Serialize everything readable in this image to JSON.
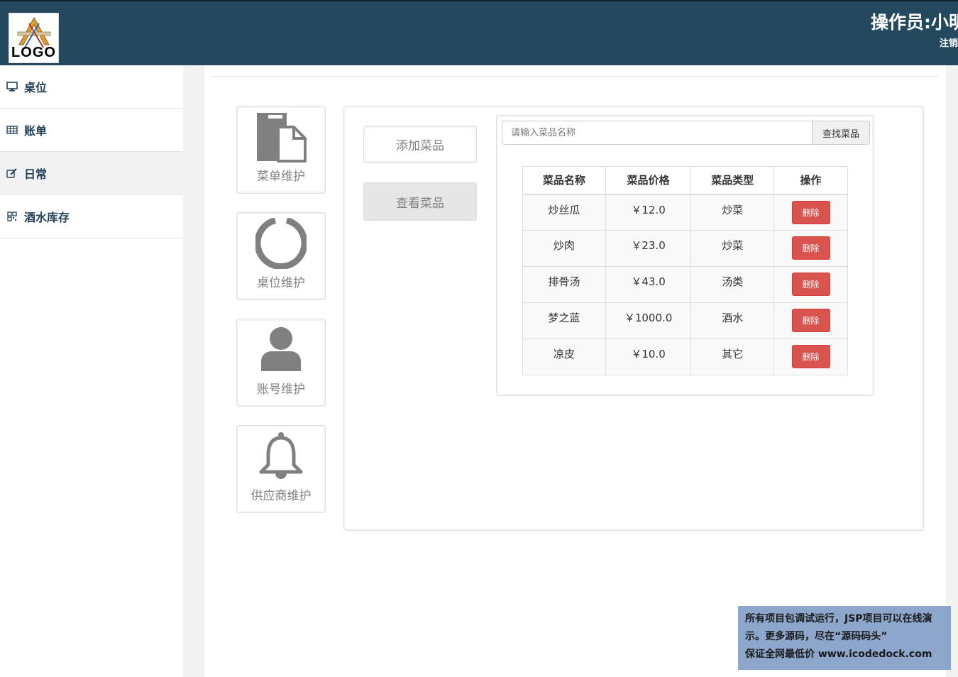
{
  "header": {
    "logo_text": "LOGO",
    "operator": "操作员:小明",
    "logout": "注销"
  },
  "sidebar": {
    "items": [
      {
        "label": "桌位",
        "icon": "monitor-icon"
      },
      {
        "label": "账单",
        "icon": "table-icon"
      },
      {
        "label": "日常",
        "icon": "edit-icon"
      },
      {
        "label": "酒水库存",
        "icon": "qrcode-icon"
      }
    ]
  },
  "tiles": [
    {
      "label": "菜单维护",
      "icon": "files-icon"
    },
    {
      "label": "桌位维护",
      "icon": "ring-icon"
    },
    {
      "label": "账号维护",
      "icon": "user-icon"
    },
    {
      "label": "供应商维护",
      "icon": "bell-icon"
    }
  ],
  "actions": {
    "add_label": "添加菜品",
    "view_label": "查看菜品"
  },
  "search": {
    "placeholder": "请输入菜品名称",
    "button_label": "查找菜品"
  },
  "table": {
    "headers": [
      "菜品名称",
      "菜品价格",
      "菜品类型",
      "操作"
    ],
    "rows": [
      {
        "name": "炒丝瓜",
        "price": "￥12.0",
        "type": "炒菜",
        "action": "删除"
      },
      {
        "name": "炒肉",
        "price": "￥23.0",
        "type": "炒菜",
        "action": "删除"
      },
      {
        "name": "排骨汤",
        "price": "￥43.0",
        "type": "汤类",
        "action": "删除"
      },
      {
        "name": "梦之蓝",
        "price": "￥1000.0",
        "type": "酒水",
        "action": "删除"
      },
      {
        "name": "凉皮",
        "price": "￥10.0",
        "type": "其它",
        "action": "删除"
      }
    ]
  },
  "watermark": {
    "line1": "所有项目包调试运行，JSP项目可以在线演",
    "line2": "示。更多源码，尽在“源码码头”",
    "line3": "保证全网最低价 www.icodedock.com"
  },
  "colors": {
    "header_bg": "#24495f",
    "sidebar_text": "#23425a",
    "danger": "#d9534f",
    "tile_icon": "#808080"
  }
}
